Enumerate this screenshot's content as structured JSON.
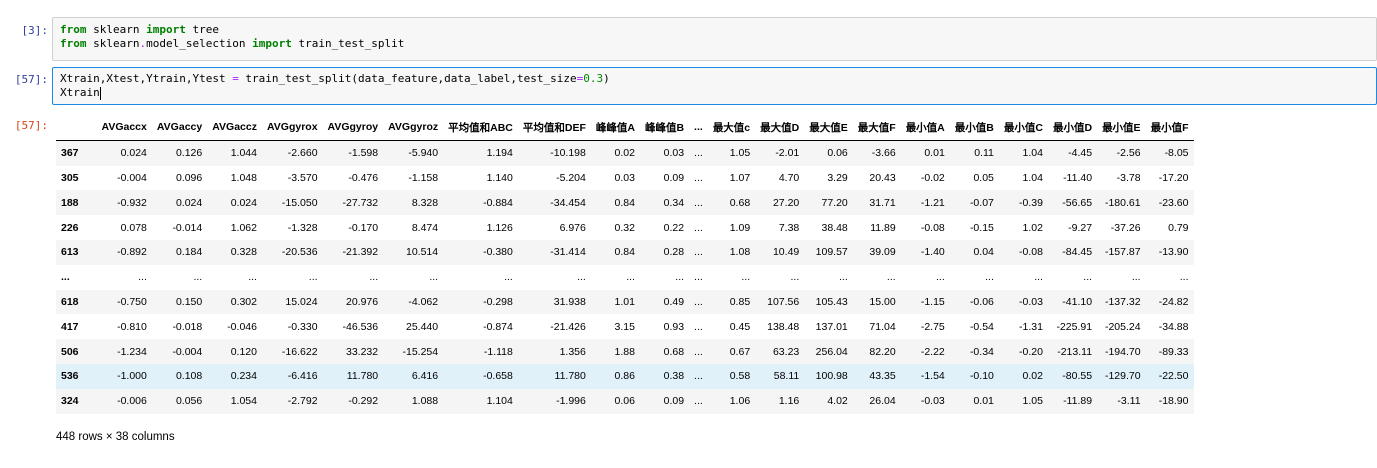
{
  "cells": [
    {
      "prompt": "[3]:",
      "lines": [
        [
          {
            "t": "from",
            "c": "kw"
          },
          {
            "t": " sklearn ",
            "c": "mod"
          },
          {
            "t": "import",
            "c": "kw"
          },
          {
            "t": " tree",
            "c": "mod"
          }
        ],
        [
          {
            "t": "from",
            "c": "kw"
          },
          {
            "t": " sklearn",
            "c": "mod"
          },
          {
            "t": ".",
            "c": "op"
          },
          {
            "t": "model_selection ",
            "c": "mod"
          },
          {
            "t": "import",
            "c": "kw"
          },
          {
            "t": " train_test_split",
            "c": "mod"
          }
        ]
      ]
    },
    {
      "prompt": "[57]:",
      "lines": [
        [
          {
            "t": "Xtrain,Xtest,Ytrain,Ytest ",
            "c": "mod"
          },
          {
            "t": "=",
            "c": "op"
          },
          {
            "t": " train_test_split(data_feature,data_label,test_size",
            "c": "mod"
          },
          {
            "t": "=",
            "c": "op"
          },
          {
            "t": "0.3",
            "c": "num"
          },
          {
            "t": ")",
            "c": "mod"
          }
        ],
        [
          {
            "t": "Xtrain",
            "c": "mod"
          }
        ]
      ]
    }
  ],
  "output_prompt": "[57]:",
  "table": {
    "columns": [
      "",
      "AVGaccx",
      "AVGaccy",
      "AVGaccz",
      "AVGgyrox",
      "AVGgyroy",
      "AVGgyroz",
      "平均值和ABC",
      "平均值和DEF",
      "峰峰值A",
      "峰峰值B",
      "...",
      "最大值c",
      "最大值D",
      "最大值E",
      "最大值F",
      "最小值A",
      "最小值B",
      "最小值C",
      "最小值D",
      "最小值E",
      "最小值F"
    ],
    "rows": [
      [
        "367",
        "0.024",
        "0.126",
        "1.044",
        "-2.660",
        "-1.598",
        "-5.940",
        "1.194",
        "-10.198",
        "0.02",
        "0.03",
        "...",
        "1.05",
        "-2.01",
        "0.06",
        "-3.66",
        "0.01",
        "0.11",
        "1.04",
        "-4.45",
        "-2.56",
        "-8.05"
      ],
      [
        "305",
        "-0.004",
        "0.096",
        "1.048",
        "-3.570",
        "-0.476",
        "-1.158",
        "1.140",
        "-5.204",
        "0.03",
        "0.09",
        "...",
        "1.07",
        "4.70",
        "3.29",
        "20.43",
        "-0.02",
        "0.05",
        "1.04",
        "-11.40",
        "-3.78",
        "-17.20"
      ],
      [
        "188",
        "-0.932",
        "0.024",
        "0.024",
        "-15.050",
        "-27.732",
        "8.328",
        "-0.884",
        "-34.454",
        "0.84",
        "0.34",
        "...",
        "0.68",
        "27.20",
        "77.20",
        "31.71",
        "-1.21",
        "-0.07",
        "-0.39",
        "-56.65",
        "-180.61",
        "-23.60"
      ],
      [
        "226",
        "0.078",
        "-0.014",
        "1.062",
        "-1.328",
        "-0.170",
        "8.474",
        "1.126",
        "6.976",
        "0.32",
        "0.22",
        "...",
        "1.09",
        "7.38",
        "38.48",
        "11.89",
        "-0.08",
        "-0.15",
        "1.02",
        "-9.27",
        "-37.26",
        "0.79"
      ],
      [
        "613",
        "-0.892",
        "0.184",
        "0.328",
        "-20.536",
        "-21.392",
        "10.514",
        "-0.380",
        "-31.414",
        "0.84",
        "0.28",
        "...",
        "1.08",
        "10.49",
        "109.57",
        "39.09",
        "-1.40",
        "0.04",
        "-0.08",
        "-84.45",
        "-157.87",
        "-13.90"
      ],
      [
        "...",
        "...",
        "...",
        "...",
        "...",
        "...",
        "...",
        "...",
        "...",
        "...",
        "...",
        "...",
        "...",
        "...",
        "...",
        "...",
        "...",
        "...",
        "...",
        "...",
        "...",
        "..."
      ],
      [
        "618",
        "-0.750",
        "0.150",
        "0.302",
        "15.024",
        "20.976",
        "-4.062",
        "-0.298",
        "31.938",
        "1.01",
        "0.49",
        "...",
        "0.85",
        "107.56",
        "105.43",
        "15.00",
        "-1.15",
        "-0.06",
        "-0.03",
        "-41.10",
        "-137.32",
        "-24.82"
      ],
      [
        "417",
        "-0.810",
        "-0.018",
        "-0.046",
        "-0.330",
        "-46.536",
        "25.440",
        "-0.874",
        "-21.426",
        "3.15",
        "0.93",
        "...",
        "0.45",
        "138.48",
        "137.01",
        "71.04",
        "-2.75",
        "-0.54",
        "-1.31",
        "-225.91",
        "-205.24",
        "-34.88"
      ],
      [
        "506",
        "-1.234",
        "-0.004",
        "0.120",
        "-16.622",
        "33.232",
        "-15.254",
        "-1.118",
        "1.356",
        "1.88",
        "0.68",
        "...",
        "0.67",
        "63.23",
        "256.04",
        "82.20",
        "-2.22",
        "-0.34",
        "-0.20",
        "-213.11",
        "-194.70",
        "-89.33"
      ],
      [
        "536",
        "-1.000",
        "0.108",
        "0.234",
        "-6.416",
        "11.780",
        "6.416",
        "-0.658",
        "11.780",
        "0.86",
        "0.38",
        "...",
        "0.58",
        "58.11",
        "100.98",
        "43.35",
        "-1.54",
        "-0.10",
        "0.02",
        "-80.55",
        "-129.70",
        "-22.50"
      ],
      [
        "324",
        "-0.006",
        "0.056",
        "1.054",
        "-2.792",
        "-0.292",
        "1.088",
        "1.104",
        "-1.996",
        "0.06",
        "0.09",
        "...",
        "1.06",
        "1.16",
        "4.02",
        "26.04",
        "-0.03",
        "0.01",
        "1.05",
        "-11.89",
        "-3.11",
        "-18.90"
      ]
    ],
    "hover_row_index": 9
  },
  "footer": "448 rows × 38 columns"
}
